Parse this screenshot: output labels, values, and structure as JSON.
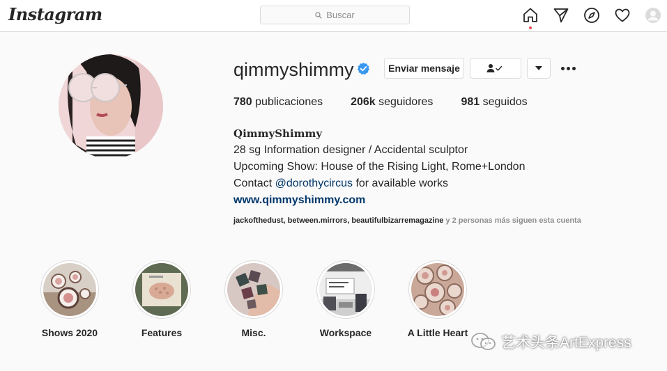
{
  "nav": {
    "logo": "Instagram",
    "search_placeholder": "Buscar",
    "icons": [
      "home-icon",
      "direct-icon",
      "explore-icon",
      "activity-heart-icon",
      "profile-avatar-icon"
    ]
  },
  "profile": {
    "username": "qimmyshimmy",
    "verified": true,
    "buttons": {
      "message": "Enviar mensaje"
    },
    "stats": {
      "posts_count": "780",
      "posts_label": "publicaciones",
      "followers_count": "206k",
      "followers_label": "seguidores",
      "following_count": "981",
      "following_label": "seguidos"
    },
    "bio": {
      "name": "QimmyShimmy",
      "line1": "28 sg Information designer / Accidental sculptor",
      "line2": "Upcoming Show: House of the Rising Light, Rome+London",
      "line3_prefix": "Contact",
      "line3_mention": "@dorothycircus",
      "line3_suffix": "for available works",
      "website": "www.qimmyshimmy.com"
    },
    "followed_by": {
      "names": "jackofthedust, between.mirrors, beautifulbizarremagazine",
      "suffix": "y 2 personas más siguen esta cuenta"
    }
  },
  "highlights": [
    {
      "label": "Shows 2020"
    },
    {
      "label": "Features"
    },
    {
      "label": "Misc."
    },
    {
      "label": "Workspace"
    },
    {
      "label": "A Little Heart"
    }
  ],
  "watermark": {
    "text": "艺术头条ArtExpress"
  },
  "colors": {
    "accent_link": "#00376b",
    "verified_blue": "#3897f0",
    "notification_red": "#ed4956",
    "border": "#dbdbdb"
  }
}
